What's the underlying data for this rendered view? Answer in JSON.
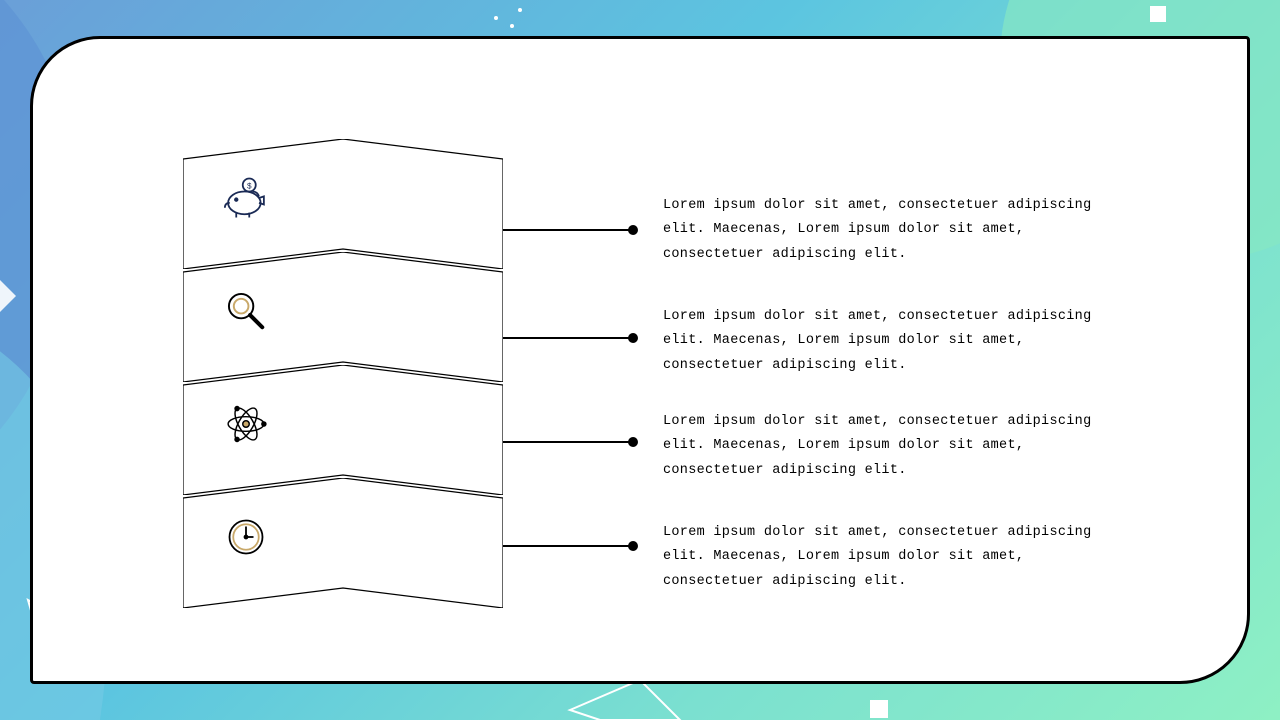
{
  "items": [
    {
      "icon": "piggy-bank-icon",
      "text": "Lorem ipsum dolor sit amet, consectetuer adipiscing elit. Maecenas, Lorem ipsum dolor sit amet, consectetuer adipiscing elit."
    },
    {
      "icon": "magnifier-icon",
      "text": "Lorem ipsum dolor sit amet, consectetuer adipiscing elit. Maecenas, Lorem ipsum dolor sit amet, consectetuer adipiscing elit."
    },
    {
      "icon": "atom-icon",
      "text": "Lorem ipsum dolor sit amet, consectetuer adipiscing elit. Maecenas, Lorem ipsum dolor sit amet, consectetuer adipiscing elit."
    },
    {
      "icon": "clock-icon",
      "text": "Lorem ipsum dolor sit amet, consectetuer adipiscing elit. Maecenas, Lorem ipsum dolor sit amet, consectetuer adipiscing elit."
    }
  ]
}
